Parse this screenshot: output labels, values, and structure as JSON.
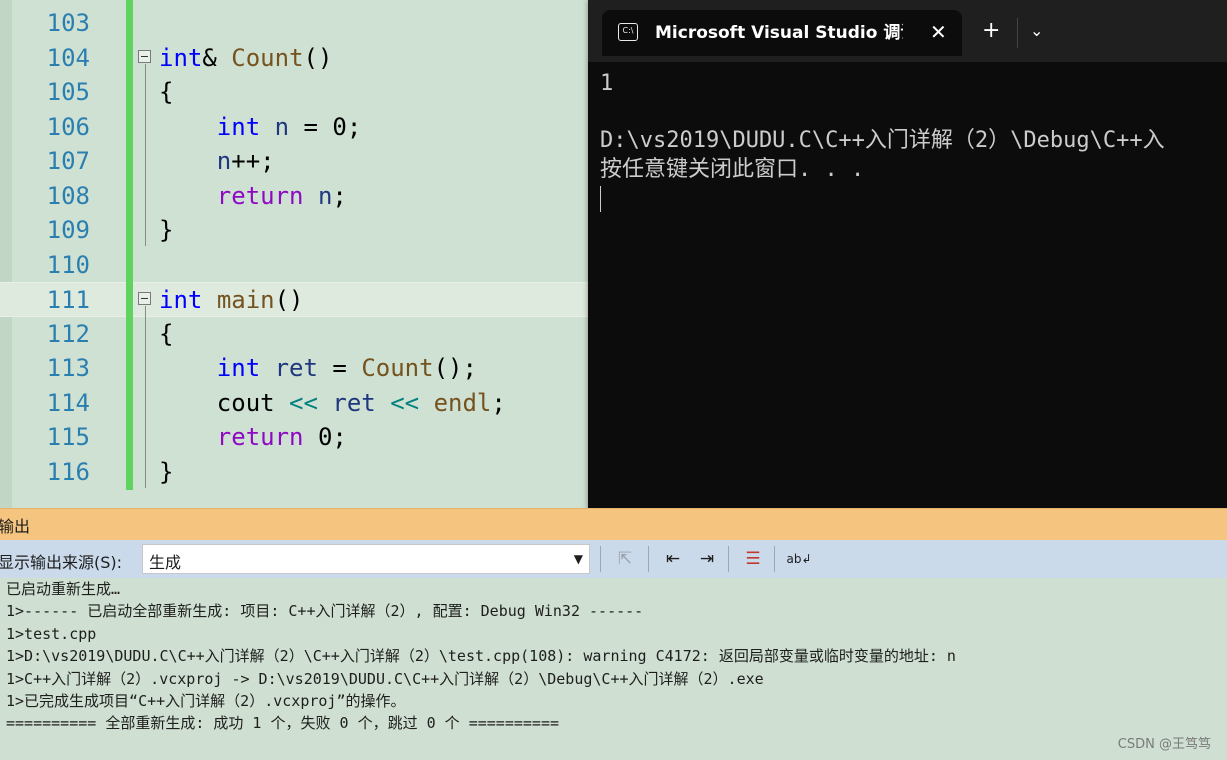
{
  "editor": {
    "lines": [
      {
        "num": "103"
      },
      {
        "num": "104",
        "parts": [
          {
            "t": "int",
            "c": "kw"
          },
          {
            "t": "& ",
            "c": ""
          },
          {
            "t": "Count",
            "c": "fn"
          },
          {
            "t": "()",
            "c": ""
          }
        ]
      },
      {
        "num": "105",
        "parts": [
          {
            "t": "{",
            "c": ""
          }
        ]
      },
      {
        "num": "106",
        "parts": [
          {
            "t": "    ",
            "c": ""
          },
          {
            "t": "int",
            "c": "kw"
          },
          {
            "t": " ",
            "c": ""
          },
          {
            "t": "n",
            "c": "var"
          },
          {
            "t": " = 0;",
            "c": ""
          }
        ]
      },
      {
        "num": "107",
        "parts": [
          {
            "t": "    ",
            "c": ""
          },
          {
            "t": "n",
            "c": "var"
          },
          {
            "t": "++;",
            "c": ""
          }
        ]
      },
      {
        "num": "108",
        "parts": [
          {
            "t": "    ",
            "c": ""
          },
          {
            "t": "return",
            "c": "ctl"
          },
          {
            "t": " ",
            "c": ""
          },
          {
            "t": "n",
            "c": "var"
          },
          {
            "t": ";",
            "c": ""
          }
        ]
      },
      {
        "num": "109",
        "parts": [
          {
            "t": "}",
            "c": ""
          }
        ]
      },
      {
        "num": "110"
      },
      {
        "num": "111",
        "parts": [
          {
            "t": "int",
            "c": "kw"
          },
          {
            "t": " ",
            "c": ""
          },
          {
            "t": "main",
            "c": "fn"
          },
          {
            "t": "()",
            "c": ""
          }
        ]
      },
      {
        "num": "112",
        "parts": [
          {
            "t": "{",
            "c": ""
          }
        ]
      },
      {
        "num": "113",
        "parts": [
          {
            "t": "    ",
            "c": ""
          },
          {
            "t": "int",
            "c": "kw"
          },
          {
            "t": " ",
            "c": ""
          },
          {
            "t": "ret",
            "c": "var"
          },
          {
            "t": " = ",
            "c": ""
          },
          {
            "t": "Count",
            "c": "fn"
          },
          {
            "t": "();",
            "c": ""
          }
        ]
      },
      {
        "num": "114",
        "parts": [
          {
            "t": "    cout ",
            "c": ""
          },
          {
            "t": "<<",
            "c": "op"
          },
          {
            "t": " ",
            "c": ""
          },
          {
            "t": "ret",
            "c": "var"
          },
          {
            "t": " ",
            "c": ""
          },
          {
            "t": "<<",
            "c": "op"
          },
          {
            "t": " ",
            "c": ""
          },
          {
            "t": "endl",
            "c": "fn"
          },
          {
            "t": ";",
            "c": ""
          }
        ]
      },
      {
        "num": "115",
        "parts": [
          {
            "t": "    ",
            "c": ""
          },
          {
            "t": "return",
            "c": "ctl"
          },
          {
            "t": " 0;",
            "c": ""
          }
        ]
      },
      {
        "num": "116",
        "parts": [
          {
            "t": "}",
            "c": ""
          }
        ]
      }
    ]
  },
  "console": {
    "tab_icon": "C:\\",
    "tab_title": "Microsoft Visual Studio 调试控制台",
    "close_glyph": "✕",
    "newtab_glyph": "+",
    "dropdown_glyph": "⌄",
    "line1": "1",
    "line2": "D:\\vs2019\\DUDU.C\\C++入门详解（2）\\Debug\\C++入",
    "line3": "按任意键关闭此窗口. . ."
  },
  "output": {
    "title": "输出",
    "source_label": "显示输出来源(S):",
    "source_value": "生成",
    "lines": [
      "已启动重新生成…",
      "1>------ 已启动全部重新生成: 项目: C++入门详解（2）, 配置: Debug Win32 ------",
      "1>test.cpp",
      "1>D:\\vs2019\\DUDU.C\\C++入门详解（2）\\C++入门详解（2）\\test.cpp(108): warning C4172: 返回局部变量或临时变量的地址: n",
      "1>C++入门详解（2）.vcxproj -> D:\\vs2019\\DUDU.C\\C++入门详解（2）\\Debug\\C++入门详解（2）.exe",
      "1>已完成生成项目“C++入门详解（2）.vcxproj”的操作。",
      "========== 全部重新生成: 成功 1 个，失败 0 个，跳过 0 个 =========="
    ]
  },
  "watermark": "CSDN @王笃笃"
}
